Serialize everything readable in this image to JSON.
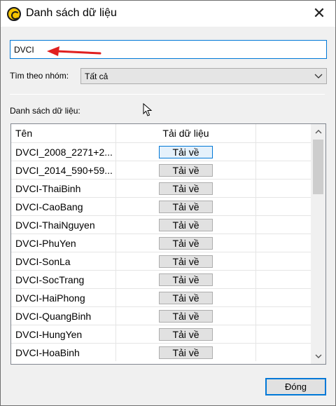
{
  "window": {
    "title": "Danh sách dữ liệu",
    "close_glyph": "✕"
  },
  "search": {
    "value": "DVCI"
  },
  "group_filter": {
    "label": "Tìm theo nhóm:",
    "selected": "Tất cả"
  },
  "list": {
    "label": "Danh sách dữ liệu:",
    "columns": [
      "Tên",
      "Tải dữ liệu",
      ""
    ],
    "rows": [
      {
        "name": "DVCI_2008_2271+2...",
        "action": "Tải về"
      },
      {
        "name": "DVCI_2014_590+59...",
        "action": "Tải về"
      },
      {
        "name": "DVCI-ThaiBinh",
        "action": "Tải về"
      },
      {
        "name": "DVCI-CaoBang",
        "action": "Tải về"
      },
      {
        "name": "DVCI-ThaiNguyen",
        "action": "Tải về"
      },
      {
        "name": "DVCI-PhuYen",
        "action": "Tải về"
      },
      {
        "name": "DVCI-SonLa",
        "action": "Tải về"
      },
      {
        "name": "DVCI-SocTrang",
        "action": "Tải về"
      },
      {
        "name": "DVCI-HaiPhong",
        "action": "Tải về"
      },
      {
        "name": "DVCI-QuangBinh",
        "action": "Tải về"
      },
      {
        "name": "DVCI-HungYen",
        "action": "Tải về"
      },
      {
        "name": "DVCI-HoaBinh",
        "action": "Tải về"
      }
    ]
  },
  "footer": {
    "close_label": "Đóng"
  },
  "colors": {
    "accent": "#0078d7",
    "annotation_arrow": "#e02020"
  },
  "icons": {
    "app": "app-logo-icon",
    "close": "close-icon",
    "dropdown": "chevron-down-icon",
    "pointer": "mouse-pointer-icon",
    "annotation": "red-arrow-icon"
  }
}
